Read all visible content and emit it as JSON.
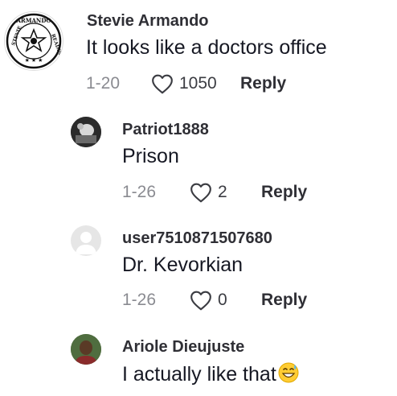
{
  "comments": [
    {
      "username": "Stevie Armando",
      "text": "It looks like a doctors office",
      "date": "1-20",
      "likes": "1050",
      "reply_label": "Reply",
      "avatar": "stevie-armando-readings-logo",
      "avatar_text": "STEVIE ARMANDO READINGS"
    },
    {
      "username": "Patriot1888",
      "text": "Prison",
      "date": "1-26",
      "likes": "2",
      "reply_label": "Reply",
      "avatar": "photo"
    },
    {
      "username": "user7510871507680",
      "text": "Dr. Kevorkian",
      "date": "1-26",
      "likes": "0",
      "reply_label": "Reply",
      "avatar": "default-placeholder"
    },
    {
      "username": "Ariole Dieujuste",
      "text": "I actually like that",
      "emoji": "grinning-face-with-sweat",
      "avatar": "photo"
    }
  ],
  "colors": {
    "text": "#161823",
    "username": "#2f2f35",
    "meta": "#8a8b91",
    "background": "#ffffff"
  },
  "icons": {
    "like": "heart-outline-icon"
  }
}
